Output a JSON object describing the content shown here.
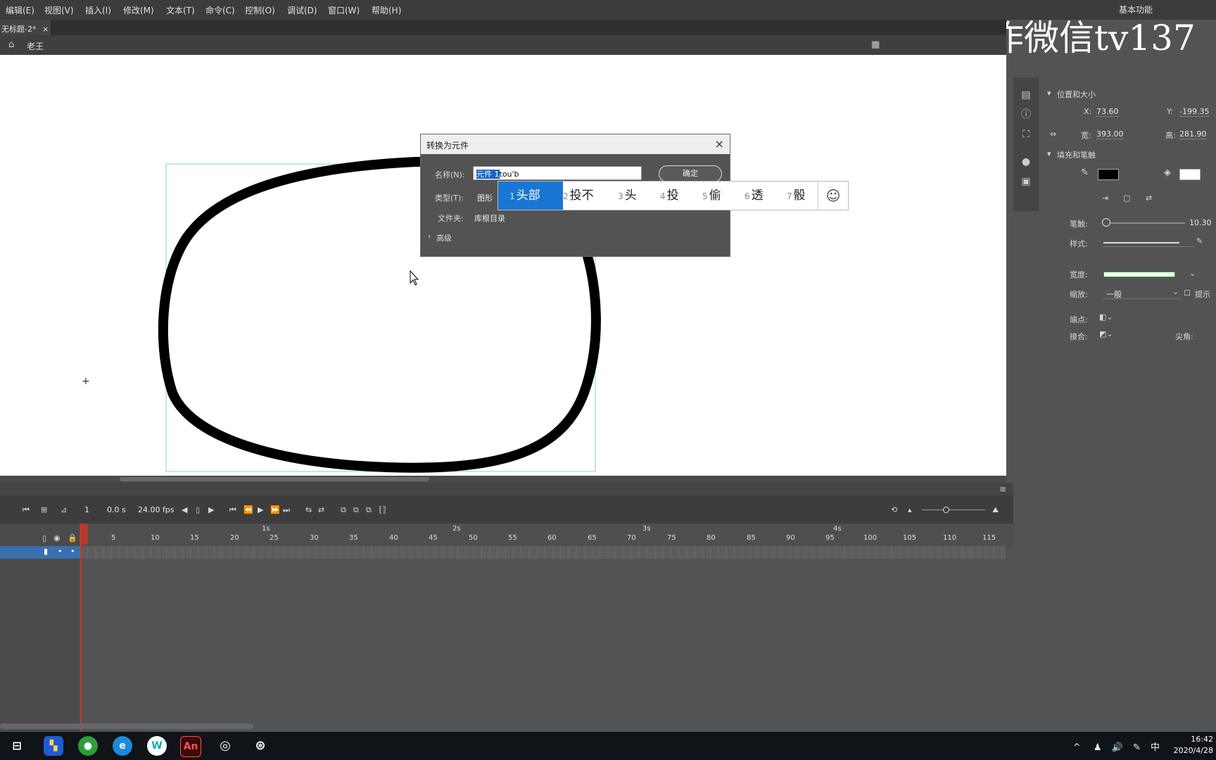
{
  "menu": [
    "编辑(E)",
    "视图(V)",
    "插入(I)",
    "修改(M)",
    "文本(T)",
    "命令(C)",
    "控制(O)",
    "调试(D)",
    "窗口(W)",
    "帮助(H)"
  ],
  "workspace_label": "基本功能",
  "watermark": "制作微信tv137",
  "doc_tab": "无标题-2*",
  "doc_tab_close": "×",
  "scene_name": "老王",
  "dialog": {
    "title": "转换为元件",
    "close": "×",
    "name_label": "名称(N):",
    "name_selected": "元件 1",
    "name_typed": "tou'b",
    "ok_label": "确定",
    "type_label": "类型(T):",
    "type_value": "图形",
    "folder_label": "文件夹:",
    "folder_value": "库根目录",
    "advanced_label": "高级"
  },
  "ime": {
    "candidates": [
      {
        "num": "1",
        "text": "头部"
      },
      {
        "num": "2",
        "text": "投不"
      },
      {
        "num": "3",
        "text": "头"
      },
      {
        "num": "4",
        "text": "投"
      },
      {
        "num": "5",
        "text": "偷"
      },
      {
        "num": "6",
        "text": "透"
      },
      {
        "num": "7",
        "text": "骰"
      }
    ],
    "emoji": "☺"
  },
  "props": {
    "section_pos": "位置和大小",
    "x_label": "X:",
    "x_value": "73.60",
    "y_label": "Y:",
    "y_value": "-199.35",
    "w_label": "宽:",
    "w_value": "393.00",
    "h_label": "高:",
    "h_value": "281.90",
    "section_fill": "填充和笔触",
    "stroke_color": "#000000",
    "fill_color": "#ffffff",
    "stroke_label": "笔触:",
    "stroke_value": "10.30",
    "style_label": "样式:",
    "width_label": "宽度:",
    "scale_label": "缩放:",
    "scale_value": "一般",
    "hint_label": "提示",
    "cap_label": "端点:",
    "join_label": "接合:",
    "miter_label": "尖角:"
  },
  "timeline": {
    "frame": "1",
    "time": "0.0 s",
    "fps": "24.00 fps",
    "ticks": [
      "1",
      "5",
      "10",
      "15",
      "20",
      "25",
      "30",
      "35",
      "40",
      "45",
      "50",
      "55",
      "60",
      "65",
      "70",
      "75",
      "80",
      "85",
      "90",
      "95",
      "100",
      "105",
      "110",
      "115"
    ],
    "seconds": [
      "1s",
      "2s",
      "3s",
      "4s"
    ]
  },
  "taskbar": {
    "clock_time": "16:42",
    "clock_date": "2020/4/28",
    "ime_indicator": "中"
  }
}
